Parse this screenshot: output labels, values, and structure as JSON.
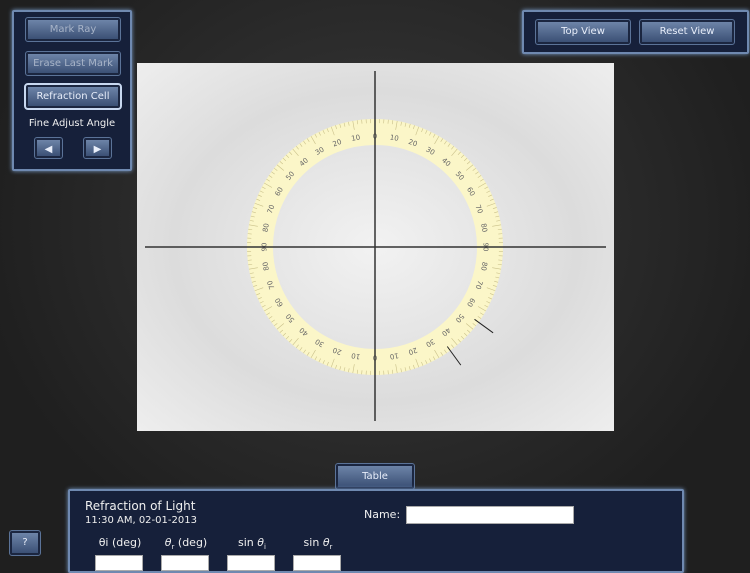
{
  "controls": {
    "mark_ray": "Mark Ray",
    "erase_last_mark": "Erase Last Mark",
    "refraction_cell": "Refraction Cell",
    "fine_adjust_label": "Fine Adjust Angle",
    "left_icon": "arrow-left-icon",
    "right_icon": "arrow-right-icon"
  },
  "view": {
    "top_view": "Top View",
    "reset_view": "Reset View"
  },
  "protractor": {
    "scale_labels": [
      0,
      10,
      20,
      30,
      40,
      50,
      60,
      70,
      80,
      90
    ],
    "marked_rays_deg": [
      36,
      54
    ],
    "ring_color": "#fbf6c8"
  },
  "table": {
    "tab_label": "Table",
    "title": "Refraction of Light",
    "timestamp": "11:30 AM, 02-01-2013",
    "name_label": "Name:",
    "name_value": "",
    "columns": [
      {
        "label": "θi (deg)",
        "sym": "θ",
        "sub": "i",
        "pre": "",
        "post": " (deg)"
      },
      {
        "sym": "θ",
        "sub": "r",
        "pre": "",
        "post": " (deg)"
      },
      {
        "sym": "θ",
        "sub": "i",
        "pre": "sin ",
        "post": ""
      },
      {
        "sym": "θ",
        "sub": "r",
        "pre": "sin ",
        "post": ""
      }
    ]
  },
  "help": "?"
}
